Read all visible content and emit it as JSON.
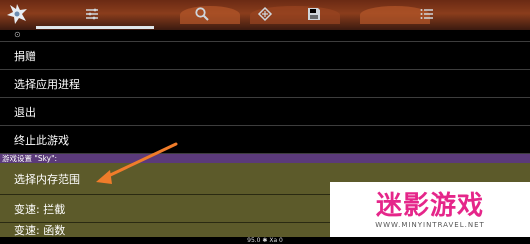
{
  "menu": {
    "items": [
      {
        "label": "捐赠"
      },
      {
        "label": "选择应用进程"
      },
      {
        "label": "退出"
      },
      {
        "label": "终止此游戏"
      }
    ],
    "section_header": "游戏设置 \"Sky\":",
    "selected_item": {
      "label": "选择内存范围"
    },
    "item_speed_intercept": {
      "label": "变速: 拦截"
    },
    "item_speed_partial": {
      "label": "变速: 函数"
    }
  },
  "status": {
    "text": "95.0 ✱ Xa 0"
  },
  "watermark": {
    "title": "迷影游戏",
    "url": "WWW.MINYINTRAVEL.NET"
  },
  "colors": {
    "section_header": "#5b3a7a",
    "selected_row": "#5c5a2a",
    "annotation_arrow": "#f07c2a",
    "watermark_title": "#e5268a"
  }
}
